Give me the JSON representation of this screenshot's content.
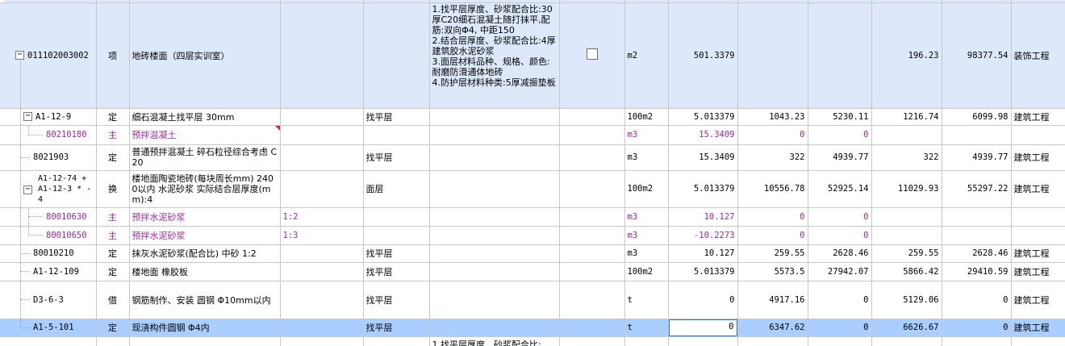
{
  "rows": [
    {
      "id": "bq1",
      "code": "011102003002",
      "type": "项",
      "name": "地砖楼面（四层实训室）",
      "spec": "",
      "part": "",
      "feature": "1.找平层厚度、砂浆配合比:30厚C20细石混凝土随打抹平,配筋:双向Φ4, 中距150\n2.结合层厚度、砂浆配合比:4厚建筑胶水泥砂浆\n3.面层材料品种、规格、颜色:耐磨防滑通体地砖\n4.防护层材料种类:5厚减振垫板",
      "unit": "m2",
      "qty": "501.3379",
      "price": "",
      "total": "",
      "price2": "196.23",
      "total2": "98377.54",
      "category": "装饰工程"
    },
    {
      "id": "r1",
      "code": "A1-12-9",
      "type": "定",
      "name": "细石混凝土找平层 30mm",
      "spec": "",
      "part": "找平层",
      "feature": "",
      "unit": "100m2",
      "qty": "5.013379",
      "price": "1043.23",
      "total": "5230.11",
      "price2": "1216.74",
      "total2": "6099.98",
      "category": "建筑工程"
    },
    {
      "id": "r2",
      "code": "80210180",
      "type": "主",
      "name": "预拌混凝土",
      "spec": "",
      "part": "",
      "feature": "",
      "unit": "m3",
      "qty": "15.3409",
      "price": "0",
      "total": "0",
      "price2": "",
      "total2": "",
      "category": ""
    },
    {
      "id": "r3",
      "code": "8021903",
      "type": "定",
      "name": "普通预拌混凝土 碎石粒径综合考虑 C20",
      "spec": "",
      "part": "找平层",
      "feature": "",
      "unit": "m3",
      "qty": "15.3409",
      "price": "322",
      "total": "4939.77",
      "price2": "322",
      "total2": "4939.77",
      "category": "建筑工程"
    },
    {
      "id": "r4",
      "code": "A1-12-74 + A1-12-3 * -4",
      "type": "换",
      "name": "楼地面陶瓷地砖(每块周长mm) 2400以内 水泥砂浆  实际结合层厚度(mm):4",
      "spec": "",
      "part": "面层",
      "feature": "",
      "unit": "100m2",
      "qty": "5.013379",
      "price": "10556.78",
      "total": "52925.14",
      "price2": "11029.93",
      "total2": "55297.22",
      "category": "建筑工程"
    },
    {
      "id": "r5",
      "code": "80010630",
      "type": "主",
      "name": "预拌水泥砂浆",
      "spec": "1:2",
      "part": "",
      "feature": "",
      "unit": "m3",
      "qty": "10.127",
      "price": "0",
      "total": "0",
      "price2": "",
      "total2": "",
      "category": ""
    },
    {
      "id": "r6",
      "code": "80010650",
      "type": "主",
      "name": "预拌水泥砂浆",
      "spec": "1:3",
      "part": "",
      "feature": "",
      "unit": "m3",
      "qty": "-10.2273",
      "price": "0",
      "total": "0",
      "price2": "",
      "total2": "",
      "category": ""
    },
    {
      "id": "r7",
      "code": "80010210",
      "type": "定",
      "name": "抹灰水泥砂浆(配合比) 中砂 1:2",
      "spec": "",
      "part": "找平层",
      "feature": "",
      "unit": "m3",
      "qty": "10.127",
      "price": "259.55",
      "total": "2628.46",
      "price2": "259.55",
      "total2": "2628.46",
      "category": "建筑工程"
    },
    {
      "id": "r8",
      "code": "A1-12-109",
      "type": "定",
      "name": "楼地面 橡胶板",
      "spec": "",
      "part": "找平层",
      "feature": "",
      "unit": "100m2",
      "qty": "5.013379",
      "price": "5573.5",
      "total": "27942.07",
      "price2": "5866.42",
      "total2": "29410.59",
      "category": "建筑工程"
    },
    {
      "id": "r9",
      "code": "D3-6-3",
      "type": "借",
      "name": "钢筋制作、安装 圆钢 Φ10mm以内",
      "spec": "",
      "part": "找平层",
      "feature": "",
      "unit": "t",
      "qty": "0",
      "price": "4917.16",
      "total": "0",
      "price2": "5129.06",
      "total2": "0",
      "category": "建筑工程"
    },
    {
      "id": "r10",
      "code": "A1-5-101",
      "type": "定",
      "name": "现浇构件圆钢 Φ4内",
      "spec": "",
      "part": "找平层",
      "feature": "",
      "unit": "t",
      "qty": "0",
      "price": "6347.62",
      "total": "0",
      "price2": "6626.67",
      "total2": "0",
      "category": "建筑工程"
    },
    {
      "id": "r11",
      "code": "",
      "type": "",
      "name": "",
      "spec": "",
      "part": "",
      "feature": "1.找平层厚度、砂浆配合比:",
      "unit": "",
      "qty": "",
      "price": "",
      "total": "",
      "price2": "",
      "total2": "",
      "category": ""
    }
  ],
  "colors": {
    "selected": "#a9ceff",
    "bq_bg": "#dde9fb",
    "main_material": "#9a2a9a",
    "flag": "#e0202a"
  }
}
